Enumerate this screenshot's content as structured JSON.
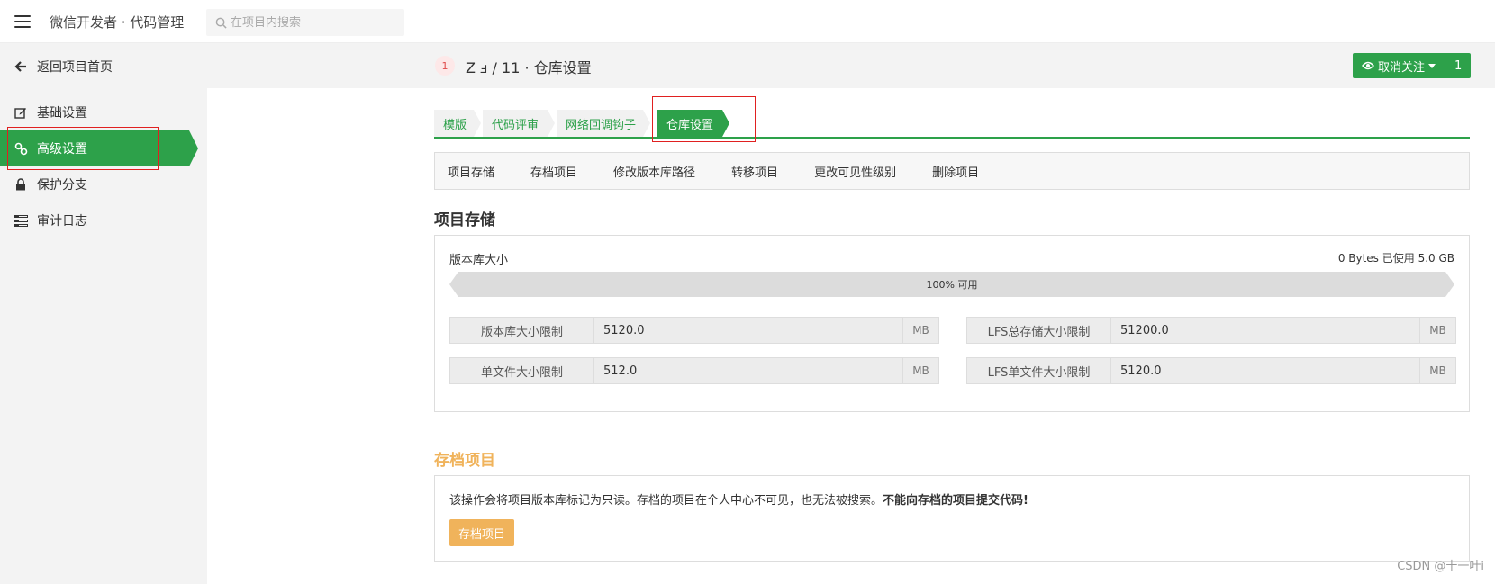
{
  "topbar": {
    "app_title": "微信开发者 · 代码管理",
    "search_placeholder": "在项目内搜索"
  },
  "sidebar": {
    "back_label": "返回项目首页",
    "items": [
      {
        "label": "基础设置",
        "icon": "edit-icon"
      },
      {
        "label": "高级设置",
        "icon": "link-icon",
        "active": true
      },
      {
        "label": "保护分支",
        "icon": "lock-icon"
      },
      {
        "label": "审计日志",
        "icon": "list-icon"
      }
    ]
  },
  "header": {
    "badge": "1",
    "breadcrumb": "Z ⅎ / 11 · 仓库设置",
    "follow_label": "取消关注",
    "follow_count": "1"
  },
  "tabs": [
    {
      "label": "模版"
    },
    {
      "label": "代码评审"
    },
    {
      "label": "网络回调钩子"
    },
    {
      "label": "仓库设置",
      "active": true
    }
  ],
  "subnav": [
    "项目存储",
    "存档项目",
    "修改版本库路径",
    "转移项目",
    "更改可见性级别",
    "删除项目"
  ],
  "storage": {
    "title": "项目存储",
    "repo_size_label": "版本库大小",
    "used_text": "0 Bytes 已使用 5.0 GB",
    "available_fraction": 1.0,
    "progress_text": "100% 可用",
    "fields": [
      {
        "label": "版本库大小限制",
        "value": "5120.0",
        "unit": "MB"
      },
      {
        "label": "LFS总存储大小限制",
        "value": "51200.0",
        "unit": "MB"
      },
      {
        "label": "单文件大小限制",
        "value": "512.0",
        "unit": "MB"
      },
      {
        "label": "LFS单文件大小限制",
        "value": "5120.0",
        "unit": "MB"
      }
    ]
  },
  "archive": {
    "title": "存档项目",
    "text": "该操作会将项目版本库标记为只读。存档的项目在个人中心不可见，也无法被搜索。",
    "bold_text": "不能向存档的项目提交代码!",
    "button_label": "存档项目"
  },
  "watermark": "CSDN @十一叶i",
  "colors": {
    "accent": "#2da14a",
    "warning": "#f0b35b",
    "highlight_box": "#e02020"
  }
}
